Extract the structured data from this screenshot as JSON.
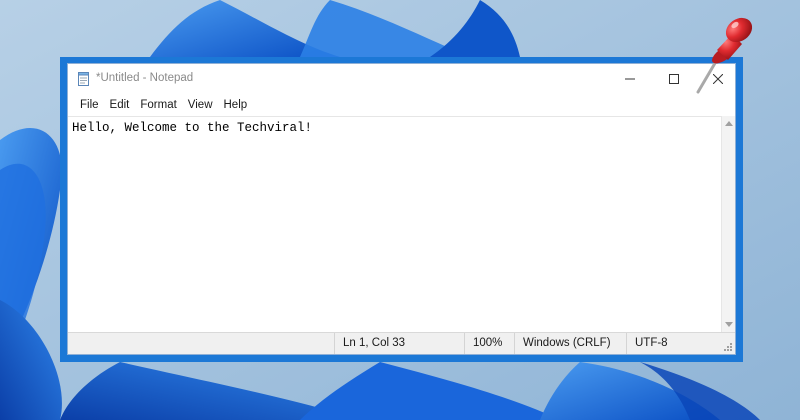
{
  "window": {
    "title": "*Untitled - Notepad"
  },
  "menu": [
    "File",
    "Edit",
    "Format",
    "View",
    "Help"
  ],
  "editor": {
    "content": "Hello, Welcome to the Techviral!"
  },
  "status": {
    "position": "Ln 1, Col 33",
    "zoom": "100%",
    "line_ending": "Windows (CRLF)",
    "encoding": "UTF-8"
  },
  "icons": {
    "app": "notepad-icon",
    "minimize": "minimize-icon",
    "maximize": "maximize-icon",
    "close": "close-icon",
    "pin": "pushpin-icon"
  },
  "colors": {
    "frame": "#1c78d6",
    "desktop_bg": "#9fc0dc",
    "wallpaper_bloom": "#1565d8",
    "pin": "#d9262c"
  }
}
